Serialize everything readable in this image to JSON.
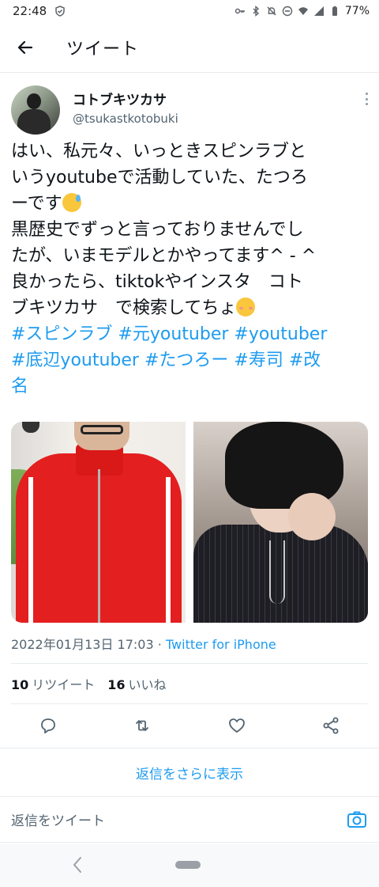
{
  "status_bar": {
    "time": "22:48",
    "battery": "77%"
  },
  "header": {
    "title": "ツイート"
  },
  "tweet": {
    "author_name": "コトブキツカサ",
    "author_handle": "@tsukastkotobuki",
    "text_lines": [
      "はい、私元々、いっときスピンラブと",
      "いうyoutubeで活動していた、たつろ",
      "ーです",
      "黒歴史でずっと言っておりませんでし",
      "たが、いまモデルとかやってます^ - ^",
      "良かったら、tiktokやインスタ　コト",
      "ブキツカサ　で検索してちょ"
    ],
    "hashtag_lines": [
      "#スピンラブ #元youtuber #youtuber",
      "#底辺youtuber #たつろー #寿司 #改",
      "名"
    ],
    "timestamp": "2022年01月13日 17:03 · ",
    "source": "Twitter for iPhone",
    "retweet_count": "10",
    "retweet_label": "リツイート",
    "like_count": "16",
    "like_label": "いいね"
  },
  "more_replies_label": "返信をさらに表示",
  "reply_placeholder": "返信をツイート",
  "icons": {
    "back": "arrow-left-icon",
    "more": "more-vertical-icon",
    "reply": "comment-icon",
    "retweet": "retweet-icon",
    "like": "heart-icon",
    "share": "share-icon",
    "camera": "camera-icon"
  },
  "colors": {
    "accent": "#1d9bf0",
    "text": "#0f1419",
    "secondary": "#536471"
  }
}
